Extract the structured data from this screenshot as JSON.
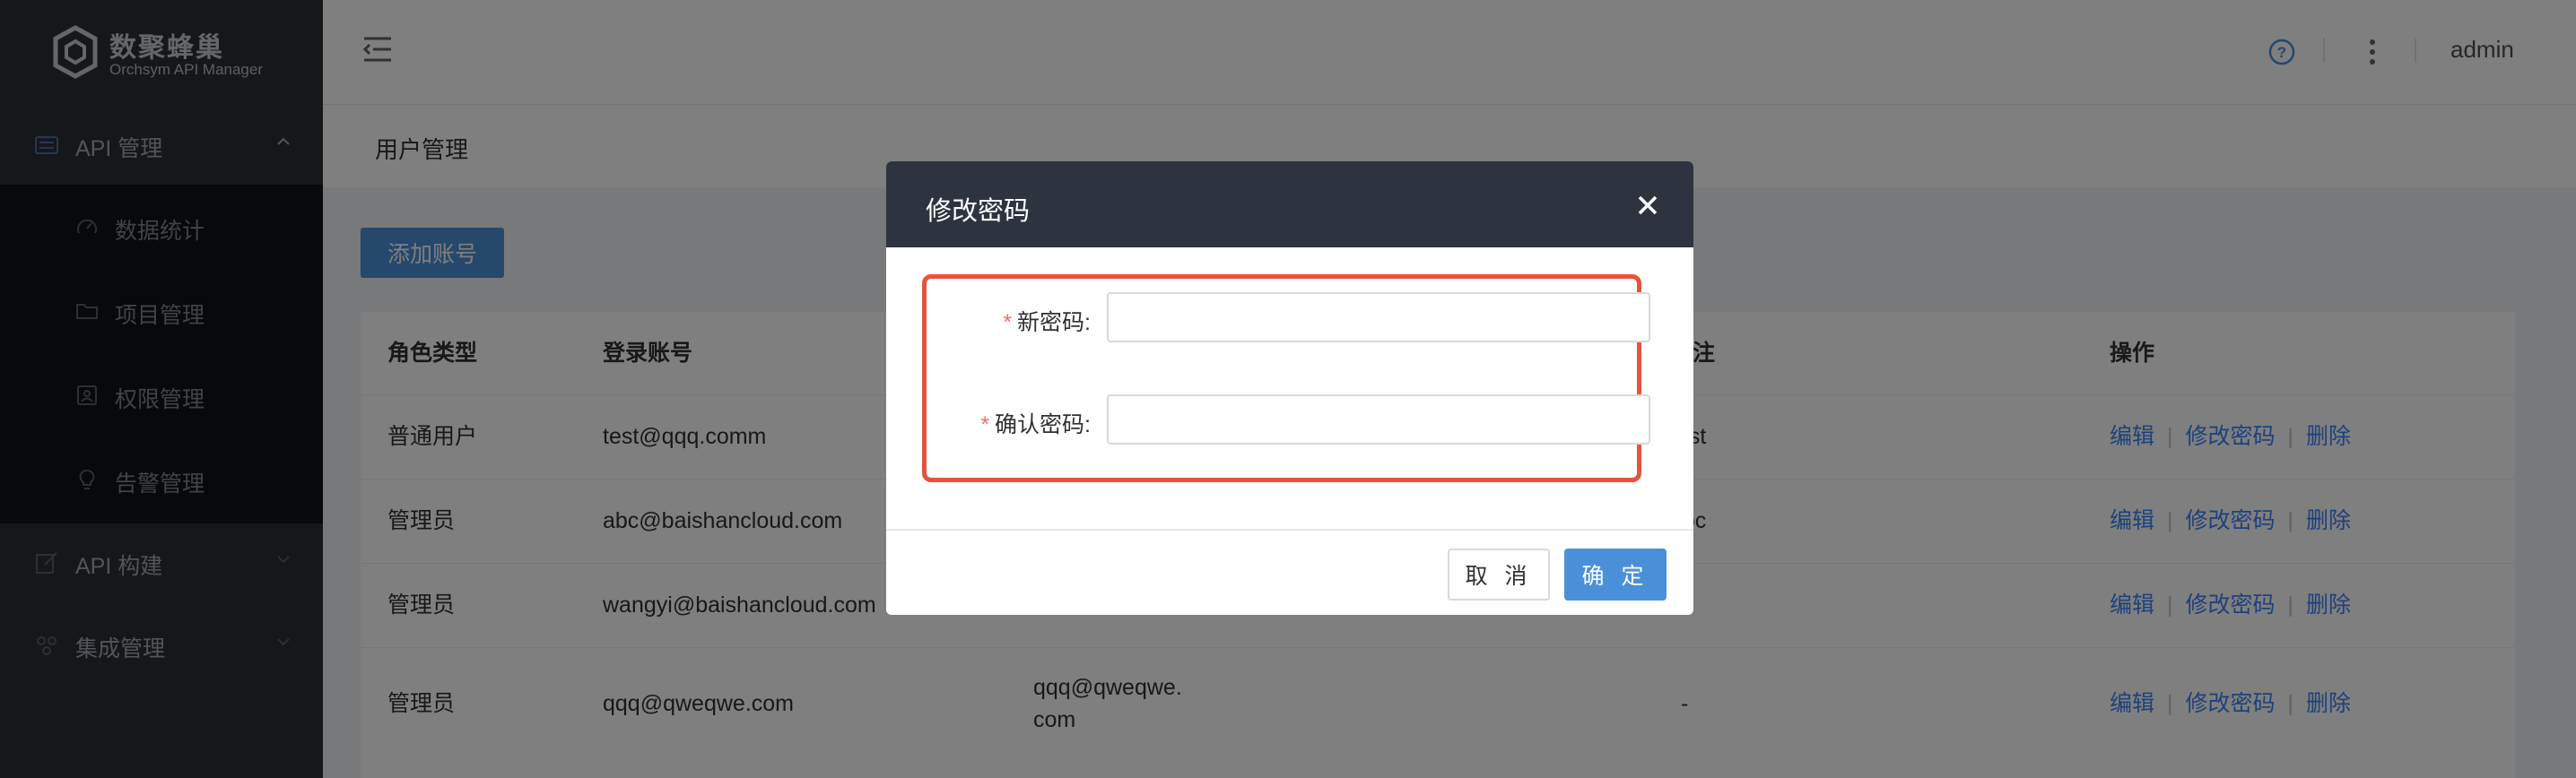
{
  "logo": {
    "title": "数聚蜂巢",
    "subtitle": "Orchsym API Manager"
  },
  "sidebar": {
    "api_mgmt": "API 管理",
    "sub_items": [
      {
        "label": "数据统计",
        "icon": "gauge-icon"
      },
      {
        "label": "项目管理",
        "icon": "folder-icon"
      },
      {
        "label": "权限管理",
        "icon": "contact-card-icon"
      },
      {
        "label": "告警管理",
        "icon": "bulb-icon"
      }
    ],
    "api_build": "API 构建",
    "integration": "集成管理"
  },
  "topbar": {
    "user": "admin"
  },
  "breadcrumb": "用户管理",
  "toolbar": {
    "add_account": "添加账号"
  },
  "table": {
    "headers": [
      "角色类型",
      "登录账号",
      "备注",
      "操作"
    ],
    "rows": [
      {
        "role": "普通用户",
        "account": "test@qqq.comm",
        "extra": "",
        "note": "test"
      },
      {
        "role": "管理员",
        "account": "abc@baishancloud.com",
        "extra": "",
        "note": "abc"
      },
      {
        "role": "管理员",
        "account": "wangyi@baishancloud.com",
        "extra": "",
        "note": ""
      },
      {
        "role": "管理员",
        "account": "qqq@qweqwe.com",
        "extra_line1": "qqq@qweqwe.",
        "extra_line2": "com",
        "note": "-"
      }
    ],
    "actions": {
      "edit": "编辑",
      "change_password": "修改密码",
      "delete": "删除"
    }
  },
  "modal": {
    "title": "修改密码",
    "required_mark": "*",
    "new_password_label": "新密码:",
    "confirm_password_label": "确认密码:",
    "new_password_value": "",
    "confirm_password_value": "",
    "cancel": "取 消",
    "confirm": "确 定"
  },
  "colors": {
    "accent": "#4a90d9",
    "highlight": "#e8533b",
    "sidebar": "#2a2e36",
    "modal_header": "#2d3440"
  }
}
